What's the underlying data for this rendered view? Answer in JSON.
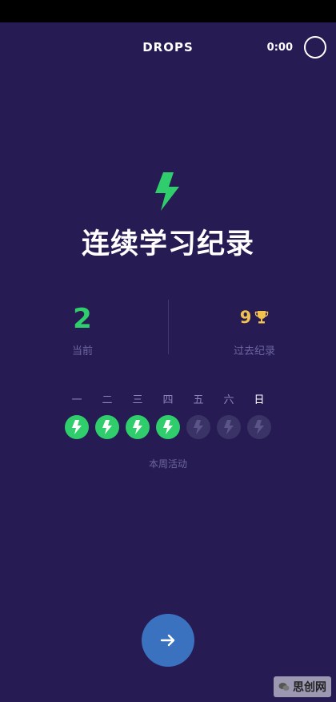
{
  "header": {
    "title": "DROPS",
    "timer": "0:00"
  },
  "hero": {
    "icon": "lightning-bolt-icon",
    "title": "连续学习纪录"
  },
  "stats": {
    "current_value": "2",
    "current_label": "当前",
    "best_value": "9",
    "best_icon": "trophy-icon",
    "best_label": "过去纪录"
  },
  "week": {
    "days": [
      {
        "label": "一",
        "done": true
      },
      {
        "label": "二",
        "done": true
      },
      {
        "label": "三",
        "done": true
      },
      {
        "label": "四",
        "done": true
      },
      {
        "label": "五",
        "done": false
      },
      {
        "label": "六",
        "done": false
      },
      {
        "label": "日",
        "done": false,
        "today": true
      }
    ],
    "caption": "本周活动"
  },
  "next_button": {
    "icon": "arrow-right-icon"
  },
  "watermark": {
    "text": "思创网"
  },
  "colors": {
    "background": "#261b52",
    "accent_green": "#2fcd6b",
    "trophy_gold": "#f2c24e",
    "button_blue": "#3a72bf",
    "inactive_badge": "#3a3466"
  }
}
